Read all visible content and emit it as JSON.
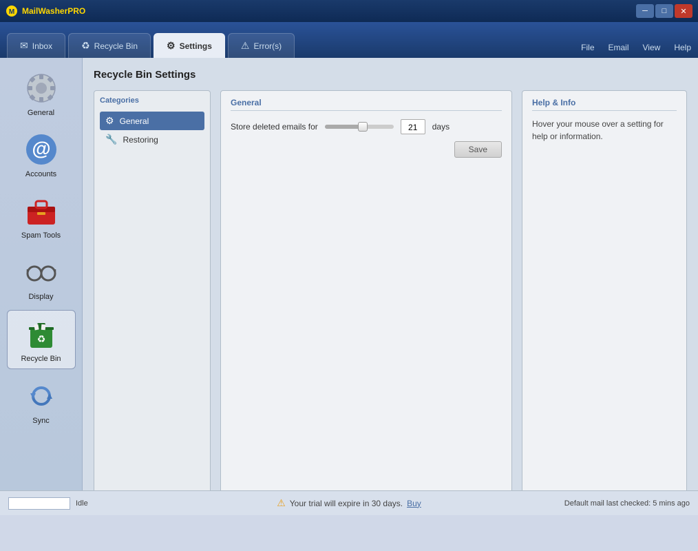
{
  "titleBar": {
    "appName": "MailWasher",
    "appNameSuffix": "PRO",
    "controls": {
      "minimize": "─",
      "maximize": "□",
      "close": "✕"
    }
  },
  "navTabs": [
    {
      "id": "inbox",
      "label": "Inbox",
      "icon": "✉",
      "active": false
    },
    {
      "id": "recycle-bin",
      "label": "Recycle Bin",
      "icon": "♻",
      "active": false
    },
    {
      "id": "settings",
      "label": "Settings",
      "icon": "⚙",
      "active": true
    },
    {
      "id": "errors",
      "label": "Error(s)",
      "icon": "⚠",
      "active": false
    }
  ],
  "menuItems": [
    "File",
    "Email",
    "View",
    "Help"
  ],
  "sidebar": {
    "items": [
      {
        "id": "general",
        "label": "General",
        "icon": "⚙",
        "active": false
      },
      {
        "id": "accounts",
        "label": "Accounts",
        "icon": "@",
        "active": false
      },
      {
        "id": "spam-tools",
        "label": "Spam Tools",
        "icon": "🧰",
        "active": false
      },
      {
        "id": "display",
        "label": "Display",
        "icon": "👓",
        "active": false
      },
      {
        "id": "recycle-bin",
        "label": "Recycle Bin",
        "icon": "♻",
        "active": true
      },
      {
        "id": "sync",
        "label": "Sync",
        "icon": "🔄",
        "active": false
      }
    ]
  },
  "contentTitle": "Recycle Bin Settings",
  "categories": {
    "header": "Categories",
    "items": [
      {
        "id": "general",
        "label": "General",
        "icon": "⚙",
        "active": true
      },
      {
        "id": "restoring",
        "label": "Restoring",
        "icon": "🔧",
        "active": false
      }
    ]
  },
  "generalSettings": {
    "header": "General",
    "storeLabel": "Store deleted emails for",
    "sliderValue": 21,
    "daysLabel": "days",
    "saveLabel": "Save",
    "sliderPercent": 55
  },
  "helpInfo": {
    "header": "Help & Info",
    "text": "Hover your mouse over a setting for help or information."
  },
  "statusBar": {
    "inputPlaceholder": "",
    "idleText": "Idle",
    "trialText": "Your trial will expire in 30 days.",
    "buyText": "Buy",
    "lastCheckedText": "Default mail last checked: 5 mins ago"
  }
}
